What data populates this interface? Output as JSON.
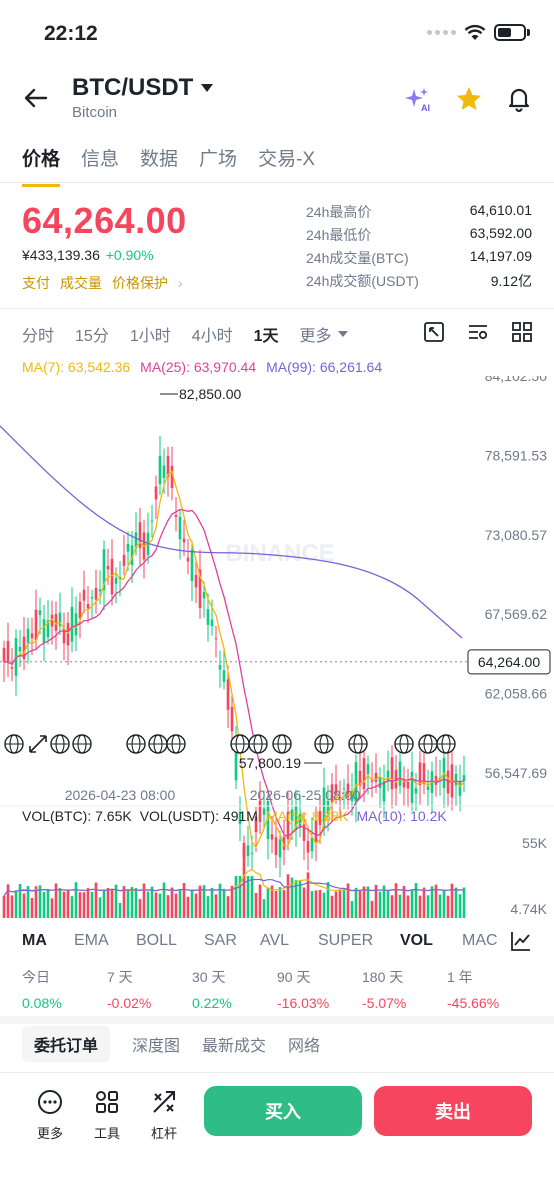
{
  "status_bar": {
    "time": "22:12"
  },
  "header": {
    "pair": "BTC/USDT",
    "subtitle": "Bitcoin",
    "ai_label": "AI"
  },
  "tabs": [
    "价格",
    "信息",
    "数据",
    "广场",
    "交易-X"
  ],
  "ticker": {
    "price": "64,264.00",
    "cny": "¥433,139.36",
    "change": "+0.90%",
    "tags": [
      "支付",
      "成交量",
      "价格保护"
    ],
    "stats": [
      {
        "label": "24h最高价",
        "value": "64,610.01"
      },
      {
        "label": "24h最低价",
        "value": "63,592.00"
      },
      {
        "label": "24h成交量(BTC)",
        "value": "14,197.09"
      },
      {
        "label": "24h成交额(USDT)",
        "value": "9.12亿"
      }
    ]
  },
  "intervals": [
    "分时",
    "15分",
    "1小时",
    "4小时",
    "1天",
    "更多"
  ],
  "ma_legend": [
    {
      "text": "MA(7): 63,542.36",
      "color": "#f0b90b"
    },
    {
      "text": "MA(25): 63,970.44",
      "color": "#e040a0"
    },
    {
      "text": "MA(99): 66,261.64",
      "color": "#7b61d8"
    }
  ],
  "chart_data": {
    "type": "candlestick",
    "y_ticks": [
      "84,102.50",
      "78,591.53",
      "73,080.57",
      "67,569.62",
      "62,058.66",
      "56,547.69"
    ],
    "ylim": [
      56547.69,
      84102.5
    ],
    "x_labels": [
      "2026-04-23 08:00",
      "2026-06-25 08:00"
    ],
    "current_price_label": "64,264.00",
    "high_annotation": "82,850.00",
    "low_annotation": "57,800.19",
    "watermark": "BINANCE",
    "series": [
      {
        "name": "MA(7)",
        "color": "#f0b90b"
      },
      {
        "name": "MA(25)",
        "color": "#e040a0"
      },
      {
        "name": "MA(99)",
        "color": "#7b61d8"
      }
    ],
    "volume": {
      "legend": {
        "btc": "VOL(BTC): 7.65K",
        "usdt": "VOL(USDT): 491M",
        "ma5": "MA(5): 8.88K",
        "ma10": "MA(10): 10.2K"
      },
      "y_ticks": [
        "55K",
        "4.74K"
      ]
    }
  },
  "indicators": [
    "MA",
    "EMA",
    "BOLL",
    "SAR",
    "AVL",
    "SUPER",
    "VOL",
    "MAC"
  ],
  "performance": [
    {
      "label": "今日",
      "value": "0.08%",
      "dir": "up"
    },
    {
      "label": "7 天",
      "value": "-0.02%",
      "dir": "down"
    },
    {
      "label": "30 天",
      "value": "0.22%",
      "dir": "up"
    },
    {
      "label": "90 天",
      "value": "-16.03%",
      "dir": "down"
    },
    {
      "label": "180 天",
      "value": "-5.07%",
      "dir": "down"
    },
    {
      "label": "1 年",
      "value": "-45.66%",
      "dir": "down"
    }
  ],
  "book_tabs": [
    "委托订单",
    "深度图",
    "最新成交",
    "网络"
  ],
  "bottom": {
    "more": "更多",
    "tools": "工具",
    "leverage": "杠杆",
    "buy": "买入",
    "sell": "卖出"
  },
  "colors": {
    "up": "#0ecb81",
    "down": "#f6465d",
    "accent": "#f0b90b"
  }
}
